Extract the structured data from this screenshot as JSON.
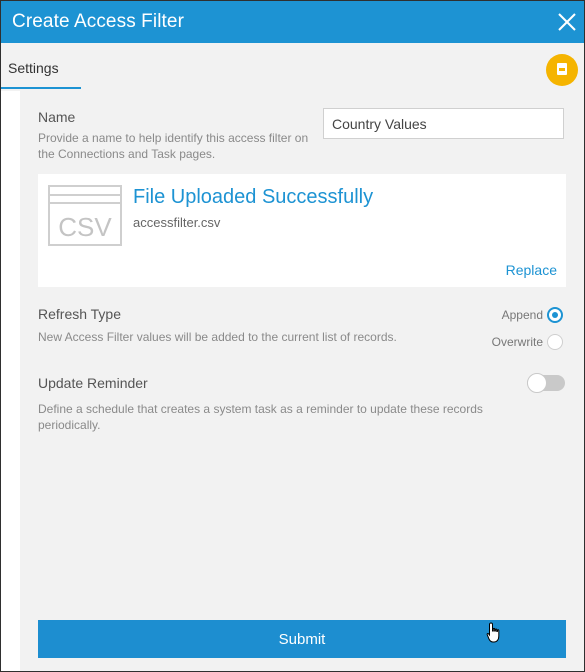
{
  "dialog": {
    "title": "Create Access Filter",
    "close_icon": "close-icon"
  },
  "tabs": [
    {
      "label": "Settings",
      "active": true
    }
  ],
  "badge_icon": "file-doc-icon",
  "name_section": {
    "label": "Name",
    "description": "Provide a name to help identify this access filter on the Connections and Task pages.",
    "value": "Country Values"
  },
  "upload": {
    "icon": "csv-file-icon",
    "icon_text": "CSV",
    "title": "File Uploaded Successfully",
    "filename": "accessfilter.csv",
    "replace_label": "Replace"
  },
  "refresh_type": {
    "label": "Refresh Type",
    "description": "New Access Filter values will be added to the current list of records.",
    "options": [
      {
        "label": "Append",
        "selected": true
      },
      {
        "label": "Overwrite",
        "selected": false
      }
    ]
  },
  "update_reminder": {
    "label": "Update Reminder",
    "description": "Define a schedule that creates a system task as a reminder to update these records periodically.",
    "enabled": false
  },
  "submit_label": "Submit",
  "colors": {
    "accent": "#1d93d3",
    "badge": "#f5b400",
    "panel_bg": "#f2f2f2"
  }
}
